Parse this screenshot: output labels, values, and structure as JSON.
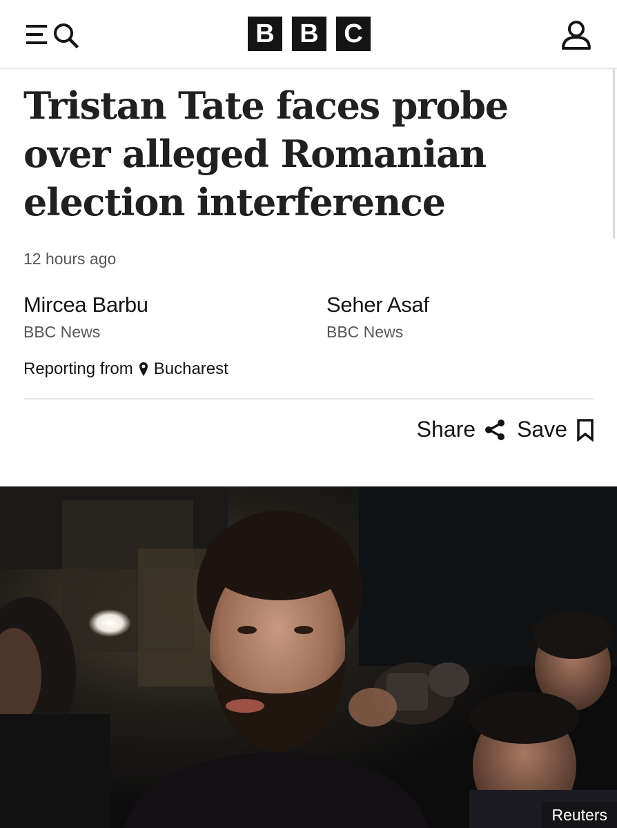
{
  "header": {
    "logo_letters": [
      "B",
      "B",
      "C"
    ],
    "menu_icon": "menu-icon",
    "search_icon": "search-icon",
    "account_icon": "account-icon"
  },
  "article": {
    "headline": "Tristan Tate faces probe over alleged Romanian election interference",
    "timestamp": "12 hours ago",
    "authors": [
      {
        "name": "Mircea Barbu",
        "org": "BBC News"
      },
      {
        "name": "Seher Asaf",
        "org": "BBC News"
      }
    ],
    "reporting_prefix": "Reporting from",
    "reporting_location": "Bucharest",
    "location_icon": "location-pin-icon",
    "actions": {
      "share_label": "Share",
      "share_icon": "share-icon",
      "save_label": "Save",
      "save_icon": "bookmark-icon"
    },
    "image_credit": "Reuters"
  },
  "colors": {
    "text": "#141414",
    "muted": "#545658",
    "divider": "#e6e6e6",
    "logo_block": "#141414"
  }
}
